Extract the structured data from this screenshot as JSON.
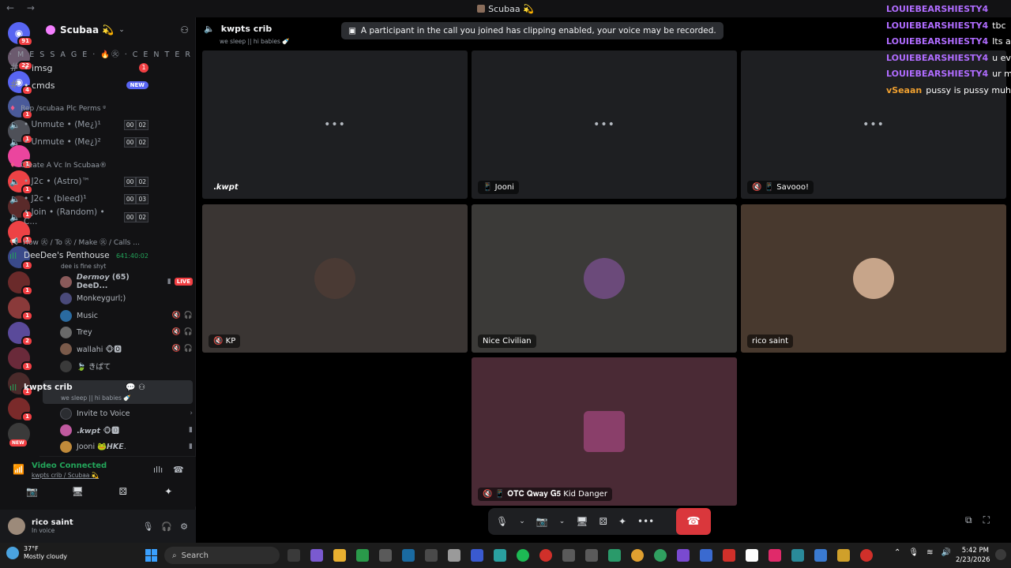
{
  "window": {
    "title": "Scubaa 💫",
    "nav": "← →"
  },
  "rail": {
    "badges": [
      "91",
      "22",
      "4",
      "1",
      "1",
      "1",
      "1",
      "1",
      "1",
      "1",
      "1",
      "1",
      "1",
      "2",
      "1",
      "1",
      "7",
      "1",
      "1",
      "1",
      "1"
    ],
    "new_label": "NEW"
  },
  "guild": {
    "name": "Scubaa 💫",
    "category_message": "· M E S S A G E · 🔥㊋ · C E N T E R ™ ·",
    "text_channels": [
      {
        "name": "• imsg",
        "badge": "1"
      },
      {
        "name": "• cmds",
        "badge": "NEW"
      }
    ],
    "sub1": "Rep /scubaa Plc Perms ᵍ",
    "voice_group1": [
      {
        "name": "• Unmute • (Me¿)¹",
        "c1": "00",
        "c2": "02"
      },
      {
        "name": "• Unmute • (Me¿)²",
        "c1": "00",
        "c2": "02"
      }
    ],
    "sub2": "Create A Vc In Scubaa®",
    "voice_group2": [
      {
        "name": "• J2c • (Astro)™",
        "c1": "00",
        "c2": "02"
      },
      {
        "name": "• J2c • (bleed)¹",
        "c1": "00",
        "c2": "03"
      },
      {
        "name": "• Join • (Random) • C...",
        "c1": "00",
        "c2": "02"
      }
    ],
    "sub3": "How ㊋ / To ㊋ / Make ㊋ / Calls ...",
    "penthouse": {
      "name": "DeeDee's Penthouse",
      "time": "641:40:02",
      "desc": "dee is fine shyt"
    },
    "penthouse_users": [
      {
        "name": "𝘿𝙚𝙧𝙢𝙤𝙮 (65) DeeD...",
        "live": "LIVE"
      },
      {
        "name": "Monkeygurl;)"
      },
      {
        "name": "Music"
      },
      {
        "name": "Trey"
      },
      {
        "name": "wallahi 🐵🅾"
      },
      {
        "name": "🍃 きぱて"
      }
    ],
    "current_channel": {
      "name": "kwpts crib",
      "desc": "we sleep || hi babies 🍼"
    },
    "invite_label": "Invite to Voice",
    "crib_users": [
      {
        "name": ".𝙠𝙬𝙥𝙩 🐵🅾"
      },
      {
        "name": "Jooni 🐸𝙃𝙆𝙀."
      }
    ]
  },
  "voice_panel": {
    "status": "Video Connected",
    "location": "kwpts crib / Scubaa 💫"
  },
  "user": {
    "name": "rico saint",
    "status": "In voice"
  },
  "stage": {
    "channel": "kwpts crib",
    "channel_desc": "we sleep || hi babies 🍼",
    "notice": "A participant in the call you joined has clipping enabled, your voice may be recorded.",
    "tiles": [
      {
        "label": ".𝙠𝙬𝙥𝙩",
        "color": "#1e1f22",
        "dots": "•••"
      },
      {
        "label": "📱 Jooni",
        "color": "#1e1f22",
        "dots": "•••"
      },
      {
        "label": "🔇 📱 Savooo!",
        "color": "#1e1f22",
        "dots": "•••"
      },
      {
        "label": "🔇 KP",
        "color": "#3a3533",
        "face_color": "#4a3a34"
      },
      {
        "label": "Nice Civilian",
        "color": "#3b3a38",
        "face_color": "#6b4a7a"
      },
      {
        "label": "rico saint",
        "color": "#48392e",
        "face_color": "#c7a58a"
      },
      {
        "label": "🔇 📱 𝐎𝐓𝐂 𝐐𝐰𝐚𝐲 𝐆𝟓 Kid Danger",
        "color": "#4a2a35",
        "face_color": "#8a3f6a"
      }
    ]
  },
  "overlay": {
    "lines": [
      {
        "user": "LOUIEBEARSHIESTY4",
        "msg": "",
        "color": "purple"
      },
      {
        "user": "LOUIEBEARSHIESTY4",
        "msg": "tbc",
        "color": "purple"
      },
      {
        "user": "LOUIEBEARSHIESTY4",
        "msg": "Its a",
        "color": "purple"
      },
      {
        "user": "LOUIEBEARSHIESTY4",
        "msg": "u ev",
        "color": "purple"
      },
      {
        "user": "LOUIEBEARSHIESTY4",
        "msg": "ur m",
        "color": "purple"
      },
      {
        "user": "vSeaan",
        "msg": "pussy is pussy muhh",
        "color": "orange"
      }
    ]
  },
  "taskbar": {
    "temp": "37°F",
    "weather": "Mostly cloudy",
    "search": "Search",
    "time": "5:42 PM",
    "date": "2/23/2026"
  }
}
